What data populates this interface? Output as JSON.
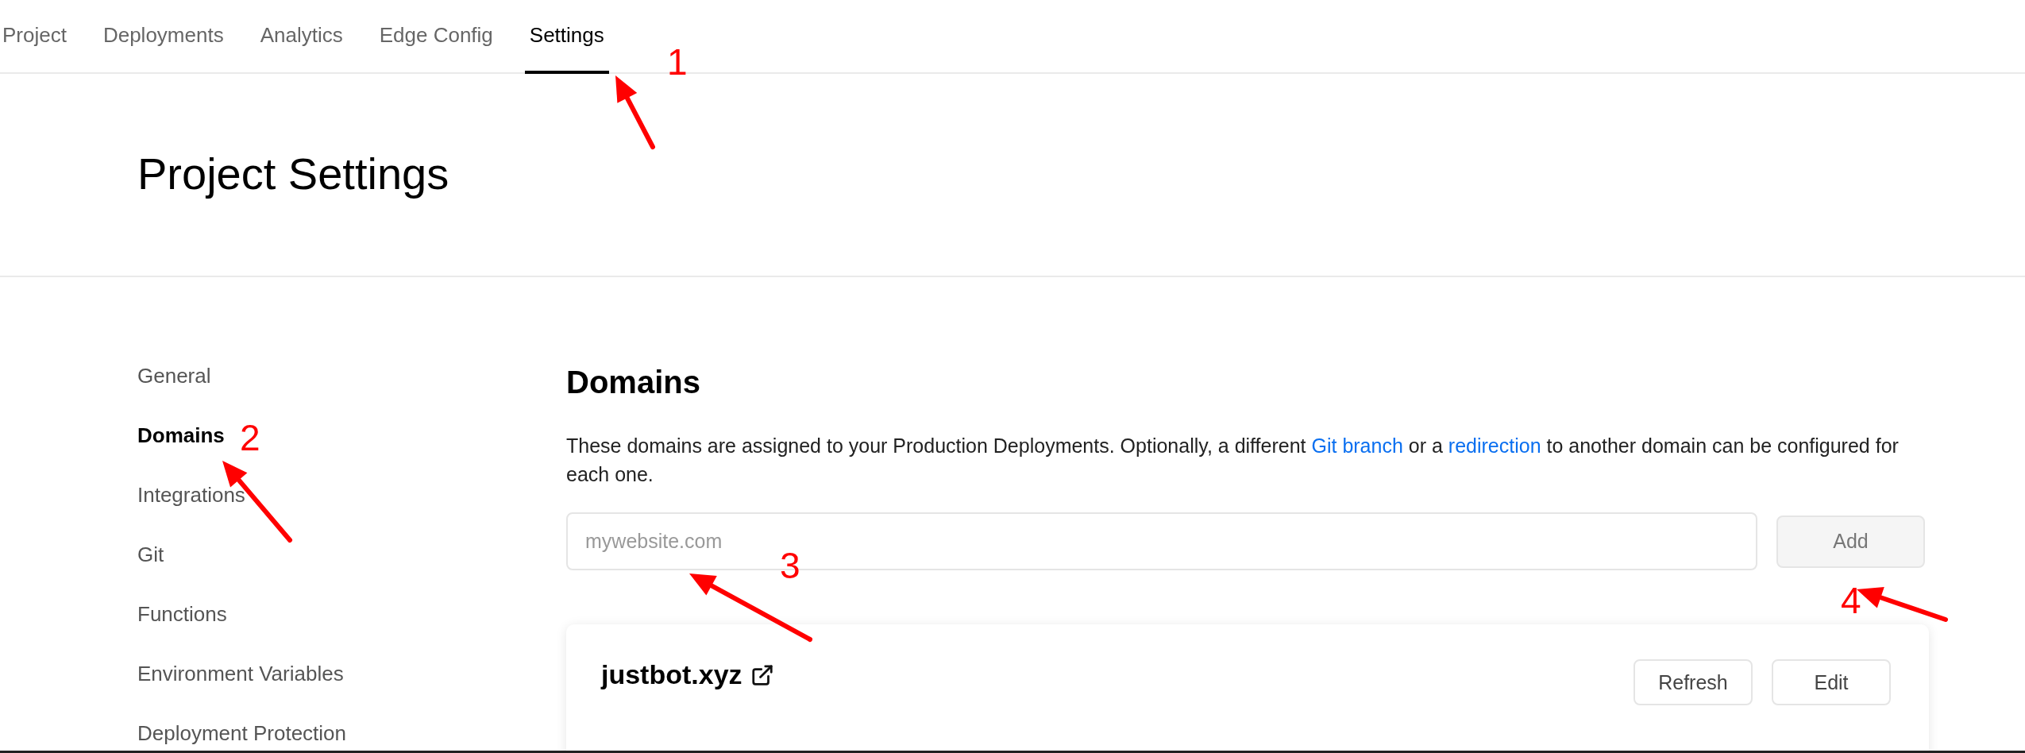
{
  "tabs": [
    {
      "label": "Project",
      "selected": false
    },
    {
      "label": "Deployments",
      "selected": false
    },
    {
      "label": "Analytics",
      "selected": false
    },
    {
      "label": "Edge Config",
      "selected": false
    },
    {
      "label": "Settings",
      "selected": true
    }
  ],
  "page_title": "Project Settings",
  "sidebar": {
    "items": [
      {
        "label": "General",
        "selected": false
      },
      {
        "label": "Domains",
        "selected": true
      },
      {
        "label": "Integrations",
        "selected": false
      },
      {
        "label": "Git",
        "selected": false
      },
      {
        "label": "Functions",
        "selected": false
      },
      {
        "label": "Environment Variables",
        "selected": false
      },
      {
        "label": "Deployment Protection",
        "selected": false
      }
    ]
  },
  "domains": {
    "heading": "Domains",
    "description": [
      {
        "kind": "text",
        "text": "These domains are assigned to your Production Deployments. Optionally, a different"
      },
      {
        "kind": "link",
        "text": "Git branch"
      },
      {
        "kind": "text",
        "text": "or a"
      },
      {
        "kind": "link",
        "text": "redirection"
      },
      {
        "kind": "text",
        "text": "to another domain can be configured for each one."
      }
    ],
    "input": {
      "placeholder": "mywebsite.com"
    },
    "add_button": "Add",
    "card": {
      "domain": "justbot.xyz",
      "buttons": [
        "Refresh",
        "Edit"
      ]
    }
  },
  "annotations": [
    {
      "label": "1"
    },
    {
      "label": "2"
    },
    {
      "label": "3"
    },
    {
      "label": "4"
    }
  ]
}
